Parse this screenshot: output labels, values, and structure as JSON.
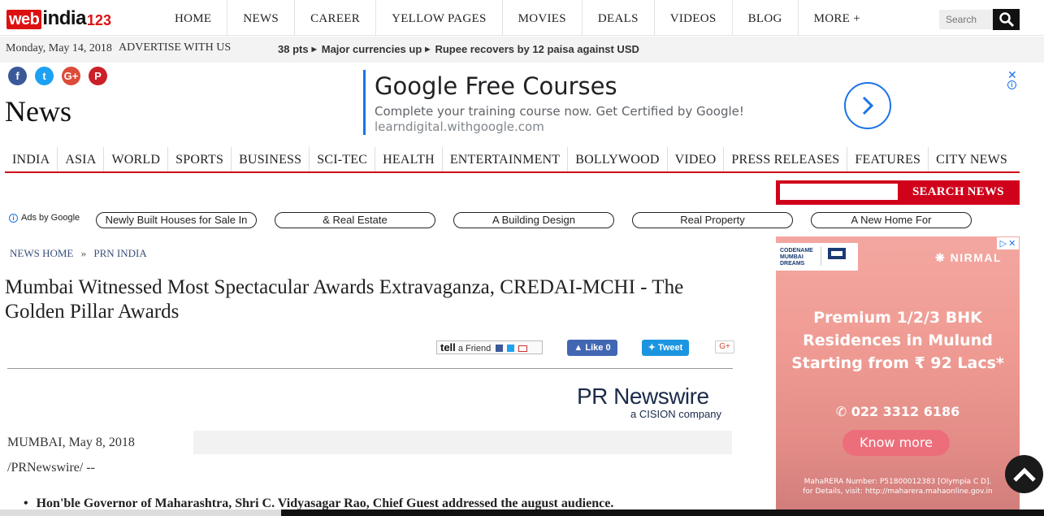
{
  "brand": {
    "logo_web": "web",
    "logo_india": "india",
    "logo_num": "123"
  },
  "nav": [
    "HOME",
    "NEWS",
    "CAREER",
    "YELLOW PAGES",
    "MOVIES",
    "DEALS",
    "VIDEOS",
    "BLOG",
    "MORE +"
  ],
  "search": {
    "placeholder": "Search"
  },
  "datebar": {
    "date": "Monday, May 14, 2018",
    "advertise": "ADVERTISE WITH US",
    "ticker": [
      "38 pts",
      "Major currencies up",
      "Rupee recovers by 12 paisa against USD"
    ]
  },
  "social_glyphs": [
    "f",
    "t",
    "G+",
    "P"
  ],
  "section_title": "News",
  "top_ad": {
    "headline": "Google Free Courses",
    "body": "Complete your training course now. Get Certified by Google!",
    "url": "learndigital.withgoogle.com",
    "close": "✕",
    "info": "i"
  },
  "categories": [
    "INDIA",
    "ASIA",
    "WORLD",
    "SPORTS",
    "BUSINESS",
    "SCI-TEC",
    "HEALTH",
    "ENTERTAINMENT",
    "BOLLYWOOD",
    "VIDEO",
    "PRESS RELEASES",
    "FEATURES",
    "CITY NEWS"
  ],
  "news_search": {
    "button": "SEARCH NEWS"
  },
  "ads_row": {
    "label": "Ads by Google",
    "pills": [
      "Newly Built Houses for Sale In",
      "& Real Estate",
      "A Building Design",
      "Real Property",
      "A New Home For"
    ]
  },
  "breadcrumb": {
    "home": "NEWS HOME",
    "sep": "»",
    "current": "PRN INDIA"
  },
  "article": {
    "title": "Mumbai Witnessed Most Spectacular Awards Extravaganza, CREDAI-MCHI - The Golden Pillar Awards",
    "dateline": "MUMBAI, May 8, 2018",
    "source": "/PRNewswire/ --",
    "bullet": "Hon'ble Governor of Maharashtra, Shri C. Vidyasagar Rao, Chief Guest addressed the august audience."
  },
  "share": {
    "tell_prefix": "tell",
    "tell_suffix": "a Friend",
    "like": "Like 0",
    "tweet": "Tweet",
    "gplus": "G+"
  },
  "prn": {
    "name": "PR Newswire",
    "sub": "a CISION company"
  },
  "side_ad": {
    "logo_text": "CODENAME MUMBAI DREAMS",
    "brand": "NIRMAL",
    "headline": "Premium 1/2/3 BHK Residences in Mulund Starting from ₹ 92 Lacs*",
    "phone": "022 3312 6186",
    "cta": "Know more",
    "rera_line1": "MahaRERA Number: P51800012383 [Olympia C D].",
    "rera_line2": "for Details, visit: http://maharera.mahaonline.gov.in"
  },
  "colors": {
    "accent_red": "#d0021b",
    "google_blue": "#1a73e8",
    "ad_pink": "#ef9b93"
  }
}
